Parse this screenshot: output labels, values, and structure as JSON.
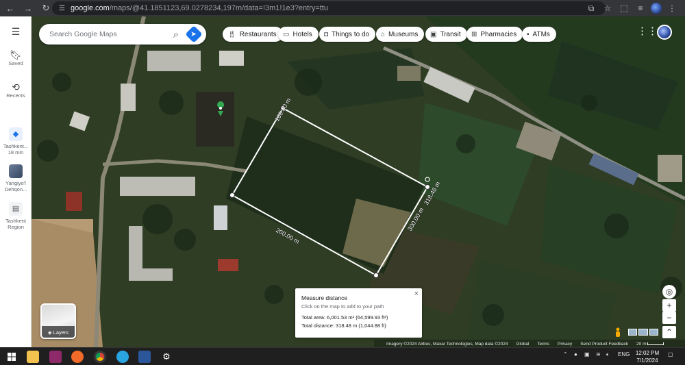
{
  "browser": {
    "url_main": "google.com",
    "url_rest": "/maps/@41.1851123,69.0278234,197m/data=!3m1!1e3?entry=ttu"
  },
  "rail": {
    "saved": "Saved",
    "recents": "Recents",
    "recent_items": [
      {
        "line1": "Tashkent...",
        "line2": "18 min"
      },
      {
        "line1": "Yangiyo'l",
        "line2": "Dehqon..."
      },
      {
        "line1": "Tashkent",
        "line2": "Region"
      }
    ]
  },
  "search": {
    "placeholder": "Search Google Maps"
  },
  "chips": [
    "Restaurants",
    "Hotels",
    "Things to do",
    "Museums",
    "Transit",
    "Pharmacies",
    "ATMs"
  ],
  "measure": {
    "labels": [
      "100.00 m",
      "200.00 m",
      "300.00 m",
      "318.48 m"
    ],
    "title": "Measure distance",
    "hint": "Click on the map to add to your path",
    "area": "Total area: 6,001.53 m² (64,599.93 ft²)",
    "distance": "Total distance: 318.48 m (1,044.88 ft)",
    "close": "×"
  },
  "layers": {
    "label": "Layers"
  },
  "footer": {
    "imagery": "Imagery ©2024 Airbus, Maxar Technologies, Map data ©2024",
    "global": "Global",
    "terms": "Terms",
    "privacy": "Privacy",
    "feedback": "Send Product Feedback",
    "scale": "20 m"
  },
  "taskbar": {
    "language": "ENG",
    "time": "12:02 PM",
    "date": "7/1/2024"
  }
}
